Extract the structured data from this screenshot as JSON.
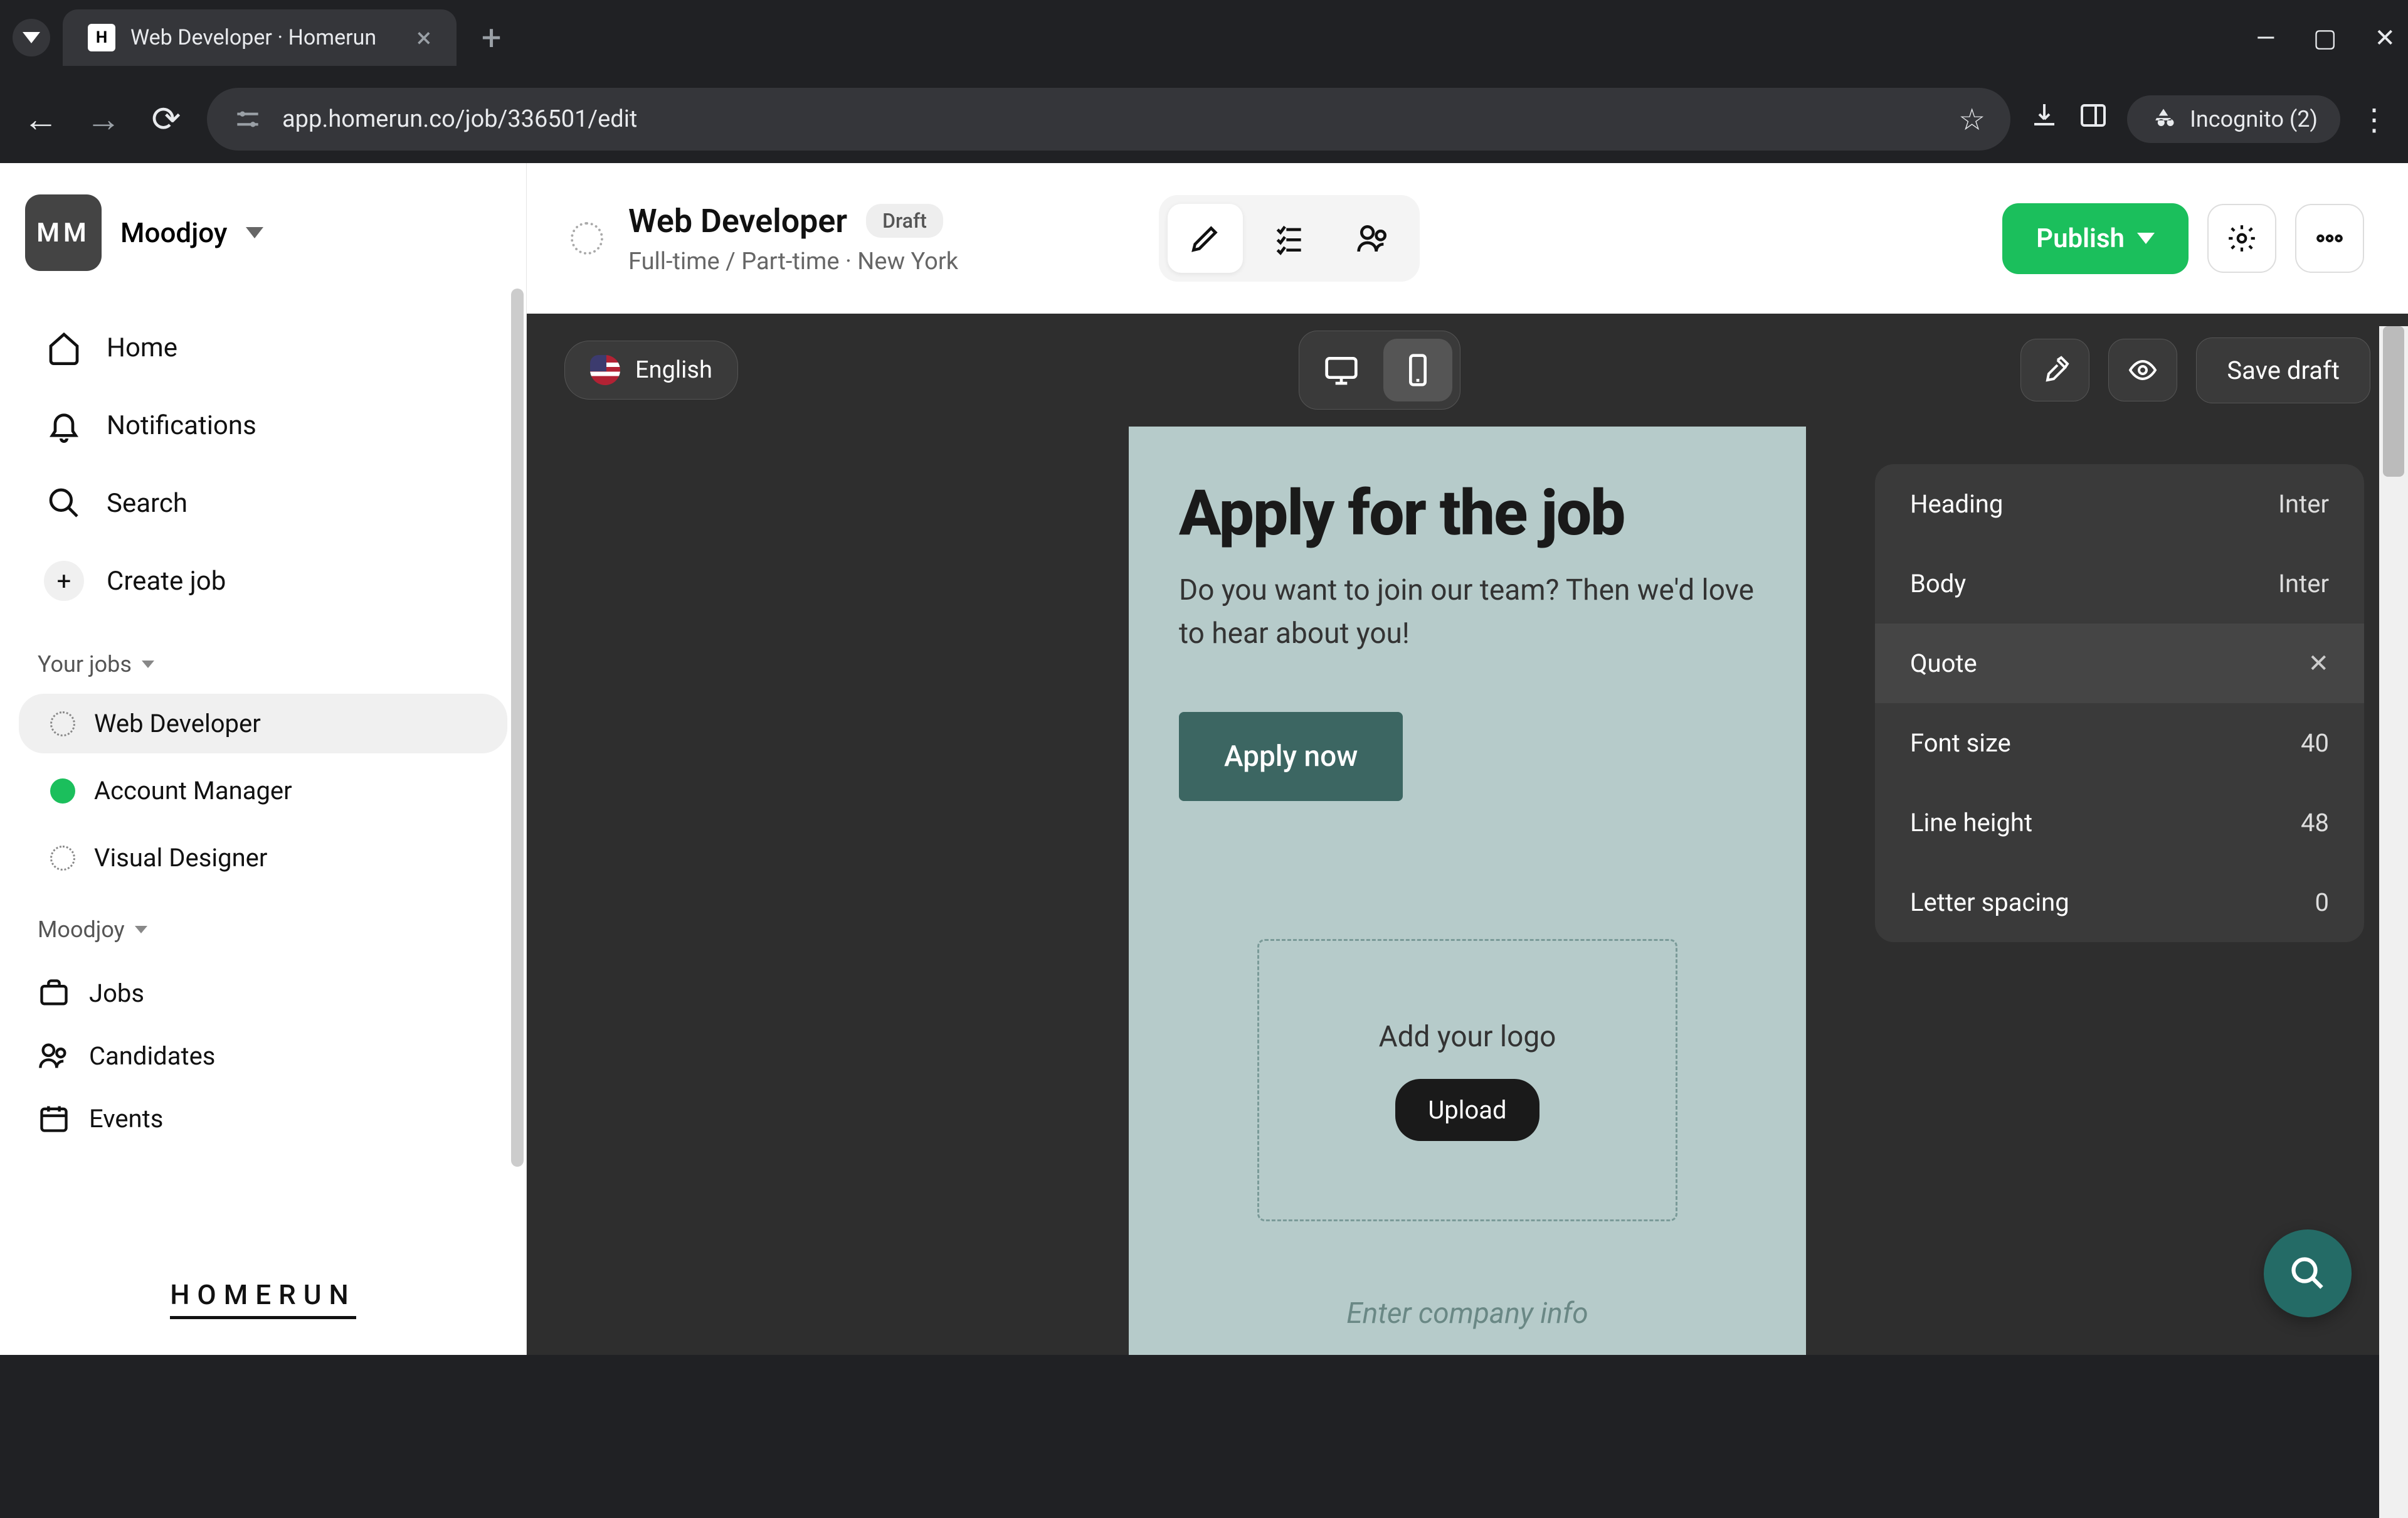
{
  "browser": {
    "tab_title": "Web Developer · Homerun",
    "url": "app.homerun.co/job/336501/edit",
    "incognito_label": "Incognito (2)"
  },
  "org": {
    "avatar_initials": "MM",
    "name": "Moodjoy"
  },
  "nav": {
    "home": "Home",
    "notifications": "Notifications",
    "search": "Search",
    "create_job": "Create job"
  },
  "sections": {
    "your_jobs": "Your jobs",
    "org_section": "Moodjoy"
  },
  "jobs": [
    {
      "name": "Web Developer",
      "status": "draft",
      "active": true
    },
    {
      "name": "Account Manager",
      "status": "live",
      "active": false
    },
    {
      "name": "Visual Designer",
      "status": "draft",
      "active": false
    }
  ],
  "bottom_nav": {
    "jobs": "Jobs",
    "candidates": "Candidates",
    "events": "Events"
  },
  "brand": "HOMERUN",
  "header": {
    "title": "Web Developer",
    "badge": "Draft",
    "meta": "Full-time / Part-time · New York",
    "publish": "Publish"
  },
  "toolbar": {
    "language": "English",
    "save_draft": "Save draft"
  },
  "canvas": {
    "heading": "Apply for the job",
    "body": "Do you want to join our team? Then we'd love to hear about you!",
    "apply_btn": "Apply now",
    "logo_label": "Add your logo",
    "upload_btn": "Upload",
    "company_placeholder": "Enter company info"
  },
  "typo_panel": {
    "heading_label": "Heading",
    "heading_font": "Inter",
    "body_label": "Body",
    "body_font": "Inter",
    "quote_label": "Quote",
    "font_size_label": "Font size",
    "font_size_value": "40",
    "line_height_label": "Line height",
    "line_height_value": "48",
    "letter_spacing_label": "Letter spacing",
    "letter_spacing_value": "0"
  }
}
